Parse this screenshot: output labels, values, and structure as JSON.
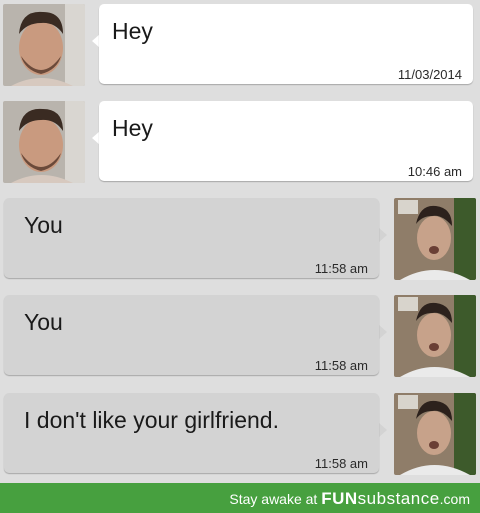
{
  "messages": [
    {
      "direction": "incoming",
      "text": "Hey",
      "time": "11/03/2014"
    },
    {
      "direction": "incoming",
      "text": "Hey",
      "time": "10:46 am"
    },
    {
      "direction": "outgoing",
      "text": "You",
      "time": "11:58 am"
    },
    {
      "direction": "outgoing",
      "text": "You",
      "time": "11:58 am"
    },
    {
      "direction": "outgoing",
      "text": "I don't like your girlfriend.",
      "time": "11:58 am"
    }
  ],
  "footer": {
    "prefix": "Stay awake at ",
    "brand_bold": "FUN",
    "brand_rest": "substance",
    "suffix": ".com"
  },
  "colors": {
    "background": "#dedede",
    "incoming_bubble": "#ffffff",
    "outgoing_bubble": "#d3d3d3",
    "footer": "#47a03f"
  }
}
